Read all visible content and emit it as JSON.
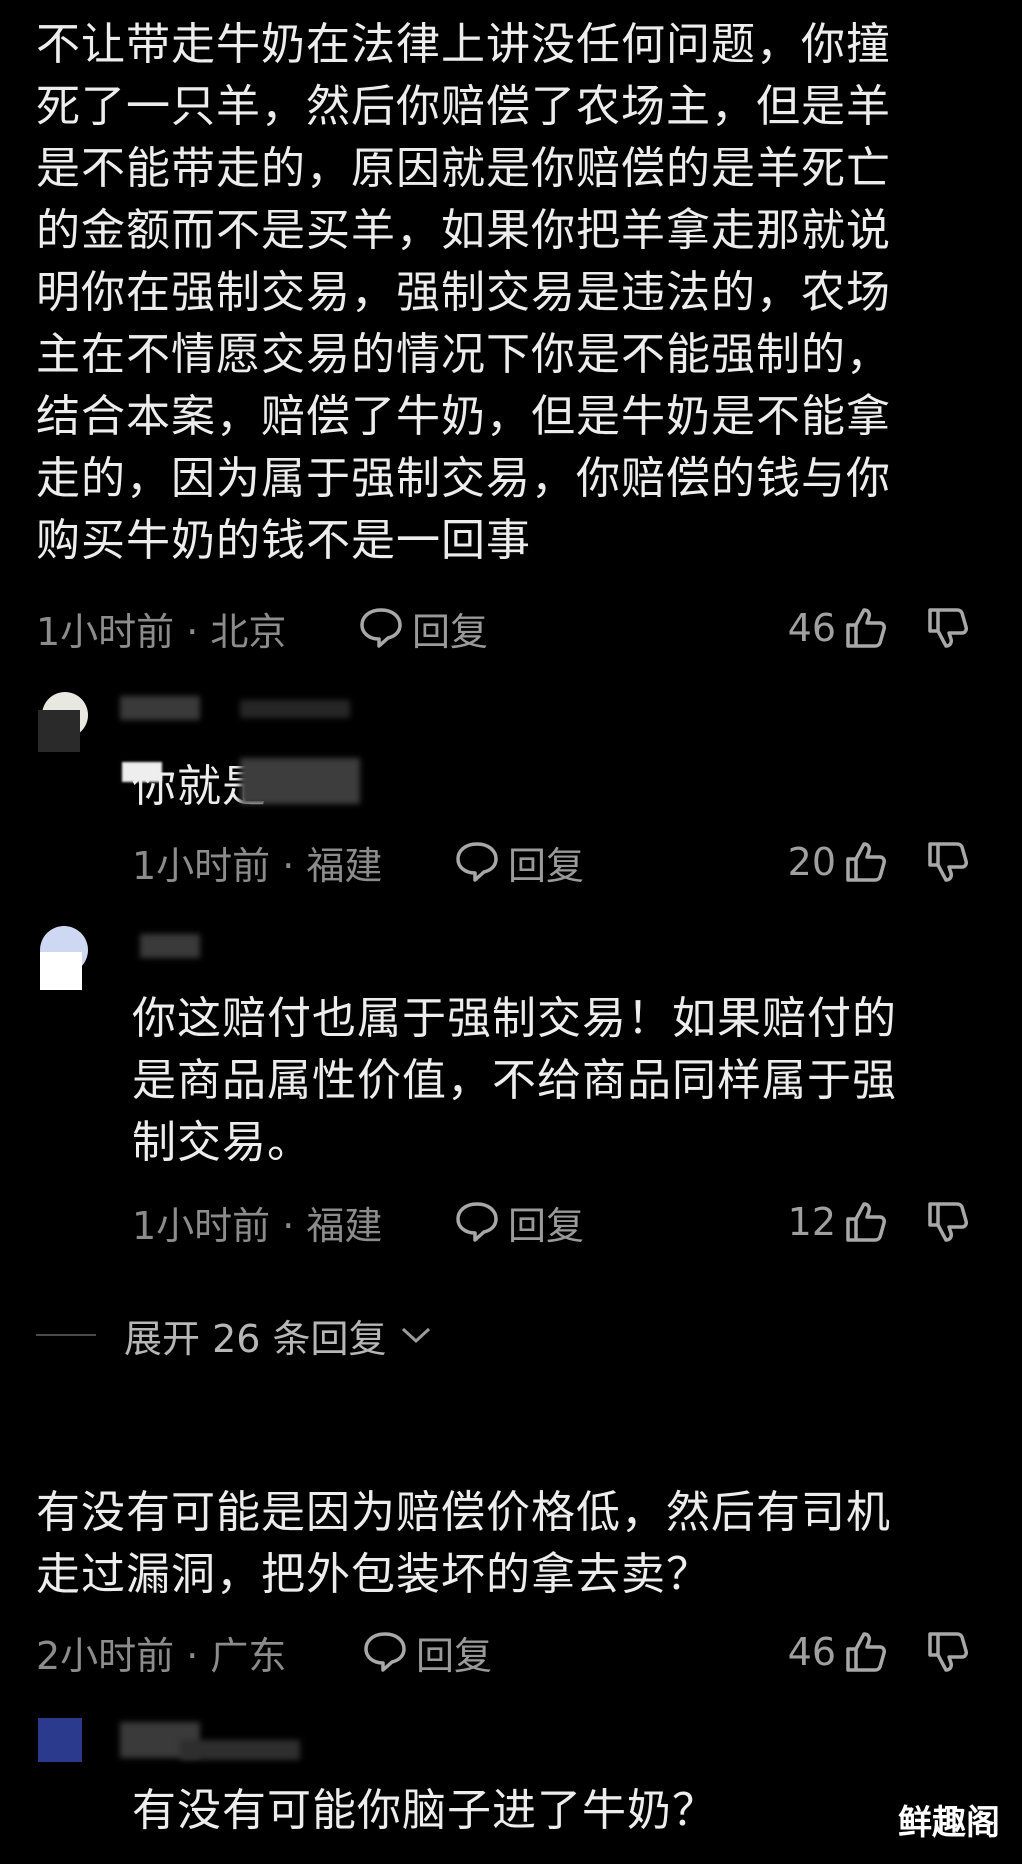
{
  "comments": [
    {
      "text": "不让带走牛奶在法律上讲没任何问题，你撞\n死了一只羊，然后你赔偿了农场主，但是羊\n是不能带走的，原因就是你赔偿的是羊死亡\n的金额而不是买羊，如果你把羊拿走那就说\n明你在强制交易，强制交易是违法的，农场\n主在不情愿交易的情况下你是不能强制的，\n结合本案，赔偿了牛奶，但是牛奶是不能拿\n走的，因为属于强制交易，你赔偿的钱与你\n购买牛奶的钱不是一回事",
      "time": "1小时前 · 北京",
      "reply_label": "回复",
      "likes": "46"
    },
    {
      "text": "你就是",
      "time": "1小时前 · 福建",
      "reply_label": "回复",
      "likes": "20"
    },
    {
      "text": "你这赔付也属于强制交易！如果赔付的\n是商品属性价值，不给商品同样属于强\n制交易。",
      "time": "1小时前 · 福建",
      "reply_label": "回复",
      "likes": "12"
    },
    {
      "text": "有没有可能是因为赔偿价格低，然后有司机\n走过漏洞，把外包装坏的拿去卖？",
      "time": "2小时前 · 广东",
      "reply_label": "回复",
      "likes": "46"
    },
    {
      "text": "有没有可能你脑子进了牛奶？"
    }
  ],
  "expand_label": "展开 26 条回复",
  "watermark": "鲜趣阁",
  "icons": {
    "reply": "comment-bubble-icon",
    "like": "thumbs-up-icon",
    "dislike": "thumbs-down-icon",
    "expand": "chevron-down-icon"
  }
}
